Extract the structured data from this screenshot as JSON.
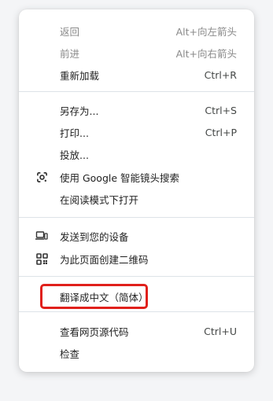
{
  "menu": {
    "back": {
      "label": "返回",
      "shortcut": "Alt+向左箭头"
    },
    "forward": {
      "label": "前进",
      "shortcut": "Alt+向右箭头"
    },
    "reload": {
      "label": "重新加载",
      "shortcut": "Ctrl+R"
    },
    "save_as": {
      "label": "另存为...",
      "shortcut": "Ctrl+S"
    },
    "print": {
      "label": "打印...",
      "shortcut": "Ctrl+P"
    },
    "cast": {
      "label": "投放..."
    },
    "google_lens": {
      "label": "使用 Google 智能镜头搜索",
      "icon": "google-lens-icon"
    },
    "reading_mode": {
      "label": "在阅读模式下打开"
    },
    "send_to_devices": {
      "label": "发送到您的设备",
      "icon": "devices-icon"
    },
    "qr_code": {
      "label": "为此页面创建二维码",
      "icon": "qr-code-icon"
    },
    "translate": {
      "label": "翻译成中文（简体）"
    },
    "view_source": {
      "label": "查看网页源代码",
      "shortcut": "Ctrl+U"
    },
    "inspect": {
      "label": "检查"
    }
  },
  "colors": {
    "highlight": "#e0201b",
    "separator": "#dde3e8"
  }
}
